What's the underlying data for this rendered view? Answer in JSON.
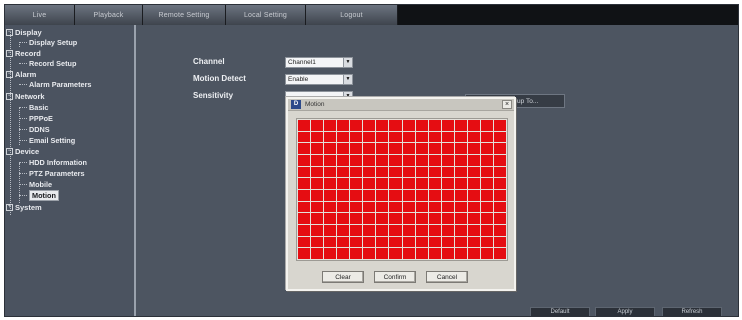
{
  "nav": {
    "tabs": [
      "Live",
      "Playback",
      "Remote Setting",
      "Local Setting",
      "Logout"
    ]
  },
  "sidebar": {
    "display": "Display",
    "display_setup": "Display Setup",
    "record": "Record",
    "record_setup": "Record Setup",
    "alarm": "Alarm",
    "alarm_parameters": "Alarm Parameters",
    "network": "Network",
    "basic": "Basic",
    "pppoe": "PPPoE",
    "ddns": "DDNS",
    "email_setting": "Email Setting",
    "device": "Device",
    "hdd_information": "HDD Information",
    "ptz_parameters": "PTZ Parameters",
    "mobile": "Mobile",
    "motion": "Motion",
    "system": "System",
    "collapse_glyph": "−",
    "expand_glyph": "+"
  },
  "form": {
    "channel_label": "Channel",
    "channel_value": "Channel1",
    "motion_detect_label": "Motion Detect",
    "motion_detect_value": "Enable",
    "sensitivity_label": "Sensitivity",
    "sensitivity_value": "",
    "area_button": "Area Setup To..."
  },
  "dialog": {
    "title": "Motion",
    "icon_glyph": "D",
    "close_glyph": "×",
    "grid": {
      "columns": 16,
      "rows": 12,
      "selected_color": "#e50d12"
    },
    "clear": "Clear",
    "confirm": "Confirm",
    "cancel": "Cancel"
  },
  "footer": {
    "default": "Default",
    "apply": "Apply",
    "refresh": "Refresh"
  },
  "icons": {
    "dropdown_arrow": "▼"
  }
}
